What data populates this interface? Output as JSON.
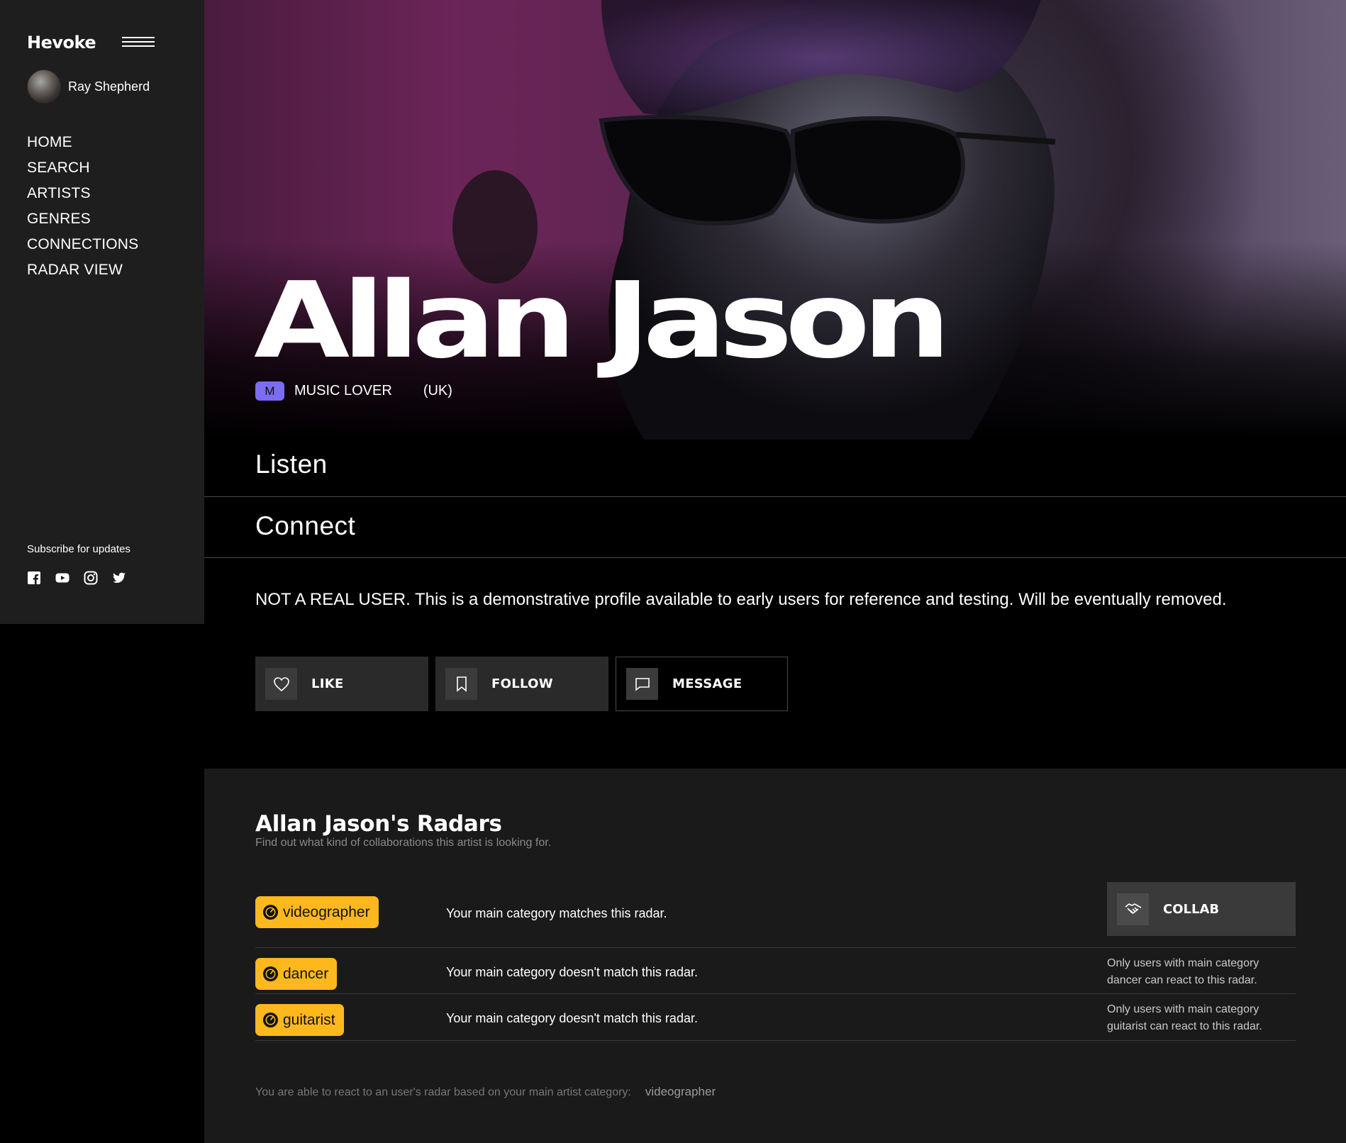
{
  "app": {
    "logo": "Hevoke"
  },
  "user": {
    "name": "Ray Shepherd"
  },
  "nav": [
    "HOME",
    "SEARCH",
    "ARTISTS",
    "GENRES",
    "CONNECTIONS",
    "RADAR VIEW"
  ],
  "sidebar_footer": {
    "subscribe": "Subscribe for updates",
    "socials": [
      "facebook-icon",
      "youtube-icon",
      "instagram-icon",
      "twitter-icon"
    ]
  },
  "profile": {
    "name": "Allan Jason",
    "badge": "M",
    "role": "MUSIC LOVER",
    "country": "(UK)",
    "badge_color": "#7b6cf0"
  },
  "sections": {
    "listen": "Listen",
    "connect": "Connect"
  },
  "disclaimer": "NOT A REAL USER. This is a demonstrative profile available to early users for reference and testing. Will be eventually removed.",
  "actions": {
    "like": "LIKE",
    "follow": "FOLLOW",
    "message": "MESSAGE"
  },
  "radars": {
    "title": "Allan Jason's Radars",
    "subtitle": "Find out what kind of collaborations this artist is looking for.",
    "accent": "#fdb81d",
    "items": [
      {
        "category": "videographer",
        "message": "Your main category matches this radar.",
        "action": "COLLAB"
      },
      {
        "category": "dancer",
        "message": "Your main category doesn't match this radar.",
        "note": "Only users with main category dancer can react to this radar."
      },
      {
        "category": "guitarist",
        "message": "Your main category doesn't match this radar.",
        "note": "Only users with main category guitarist can react to this radar."
      }
    ],
    "footer_text": "You are able to react to an user's radar based on your main artist category:",
    "footer_category": "videographer"
  }
}
